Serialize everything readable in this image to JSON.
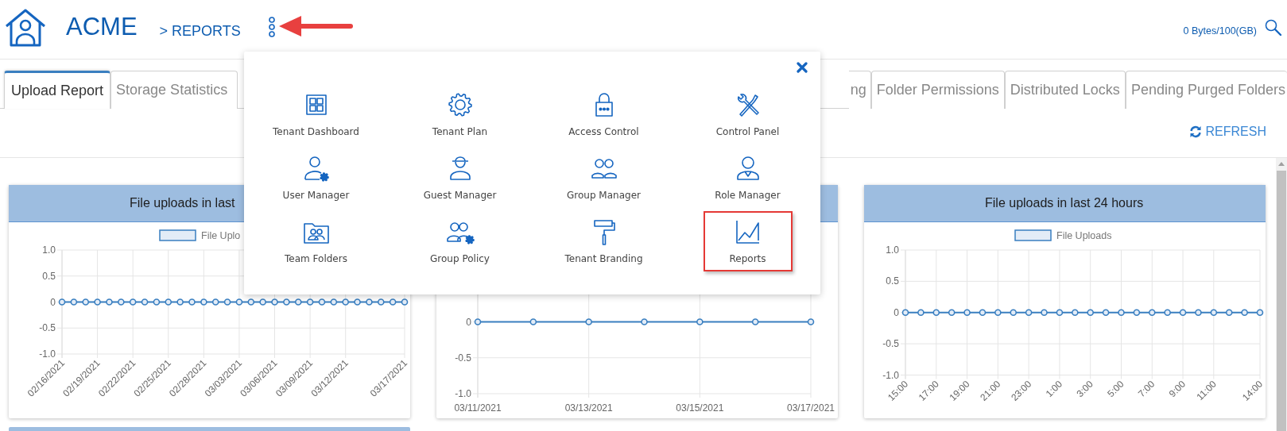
{
  "header": {
    "brand": "ACME",
    "breadcrumb": "> REPORTS",
    "storage": "0 Bytes/100(GB)"
  },
  "tabs": [
    {
      "label": "Upload Report",
      "selected": true
    },
    {
      "label": "Storage Statistics",
      "selected": false
    },
    {
      "label": "ng",
      "selected": false
    },
    {
      "label": "Folder Permissions",
      "selected": false
    },
    {
      "label": "Distributed Locks",
      "selected": false
    },
    {
      "label": "Pending Purged Folders",
      "selected": false
    }
  ],
  "toolbar": {
    "refresh": "REFRESH"
  },
  "charts": [
    {
      "title": "File uploads in last",
      "chart_data": {
        "type": "line",
        "grid": true,
        "categories": [
          "02/16/2021",
          null,
          null,
          "02/19/2021",
          null,
          null,
          "02/22/2021",
          null,
          null,
          "02/25/2021",
          null,
          null,
          "02/28/2021",
          null,
          null,
          "03/03/2021",
          null,
          null,
          "03/06/2021",
          null,
          null,
          "03/09/2021",
          null,
          null,
          "03/12/2021",
          null,
          null,
          null,
          null,
          "03/17/2021"
        ],
        "series": [
          {
            "name": "File Uplo",
            "color": "#3a7fc0",
            "marker": "circle",
            "values": [
              0,
              0,
              0,
              0,
              0,
              0,
              0,
              0,
              0,
              0,
              0,
              0,
              0,
              0,
              0,
              0,
              0,
              0,
              0,
              0,
              0,
              0,
              0,
              0,
              0,
              0,
              0,
              0,
              0,
              0
            ]
          }
        ],
        "ylim": [
          -1,
          1
        ],
        "yticks": [
          {
            "value": 1,
            "label": "1.0"
          },
          {
            "value": 0.5,
            "label": "0.5"
          },
          {
            "value": 0,
            "label": "0"
          },
          {
            "value": -0.5,
            "label": "-0.5"
          },
          {
            "value": -1,
            "label": "-1.0"
          }
        ]
      }
    },
    {
      "chart_data": {
        "type": "line",
        "grid": true,
        "categories": [
          "03/11/2021",
          null,
          "03/13/2021",
          null,
          "03/15/2021",
          null,
          "03/17/2021"
        ],
        "series": [
          {
            "color": "#3a7fc0",
            "marker": "circle",
            "values": [
              0,
              0,
              0,
              0,
              0,
              0,
              0
            ]
          }
        ],
        "ylim": [
          -1,
          1
        ],
        "yticks": [
          {
            "value": 0,
            "label": "0"
          },
          {
            "value": -0.5,
            "label": "-0.5"
          },
          {
            "value": -1,
            "label": "-1.0"
          }
        ]
      }
    },
    {
      "title": "File uploads in last 24 hours",
      "chart_data": {
        "type": "line",
        "grid": true,
        "categories": [
          "15:00",
          null,
          "17:00",
          null,
          "19:00",
          null,
          "21:00",
          null,
          "23:00",
          null,
          "1:00",
          null,
          "3:00",
          null,
          "5:00",
          null,
          "7:00",
          null,
          "9:00",
          null,
          "11:00",
          null,
          null,
          "14:00"
        ],
        "series": [
          {
            "name": "File Uploads",
            "color": "#3a7fc0",
            "marker": "circle",
            "values": [
              0,
              0,
              0,
              0,
              0,
              0,
              0,
              0,
              0,
              0,
              0,
              0,
              0,
              0,
              0,
              0,
              0,
              0,
              0,
              0,
              0,
              0,
              0,
              0
            ]
          }
        ],
        "ylim": [
          -1,
          1
        ],
        "yticks": [
          {
            "value": 1,
            "label": "1.0"
          },
          {
            "value": 0.5,
            "label": "0.5"
          },
          {
            "value": 0,
            "label": "0"
          },
          {
            "value": -0.5,
            "label": "-0.5"
          },
          {
            "value": -1,
            "label": "-1.0"
          }
        ]
      }
    }
  ],
  "menu": {
    "items": [
      {
        "label": "Tenant Dashboard",
        "selected": false
      },
      {
        "label": "Tenant Plan",
        "selected": false
      },
      {
        "label": "Access Control",
        "selected": false
      },
      {
        "label": "Control Panel",
        "selected": false
      },
      {
        "label": "User Manager",
        "selected": false
      },
      {
        "label": "Guest Manager",
        "selected": false
      },
      {
        "label": "Group Manager",
        "selected": false
      },
      {
        "label": "Role Manager",
        "selected": false
      },
      {
        "label": "Team Folders",
        "selected": false
      },
      {
        "label": "Group Policy",
        "selected": false
      },
      {
        "label": "Tenant Branding",
        "selected": false
      },
      {
        "label": "Reports",
        "selected": true
      }
    ]
  }
}
